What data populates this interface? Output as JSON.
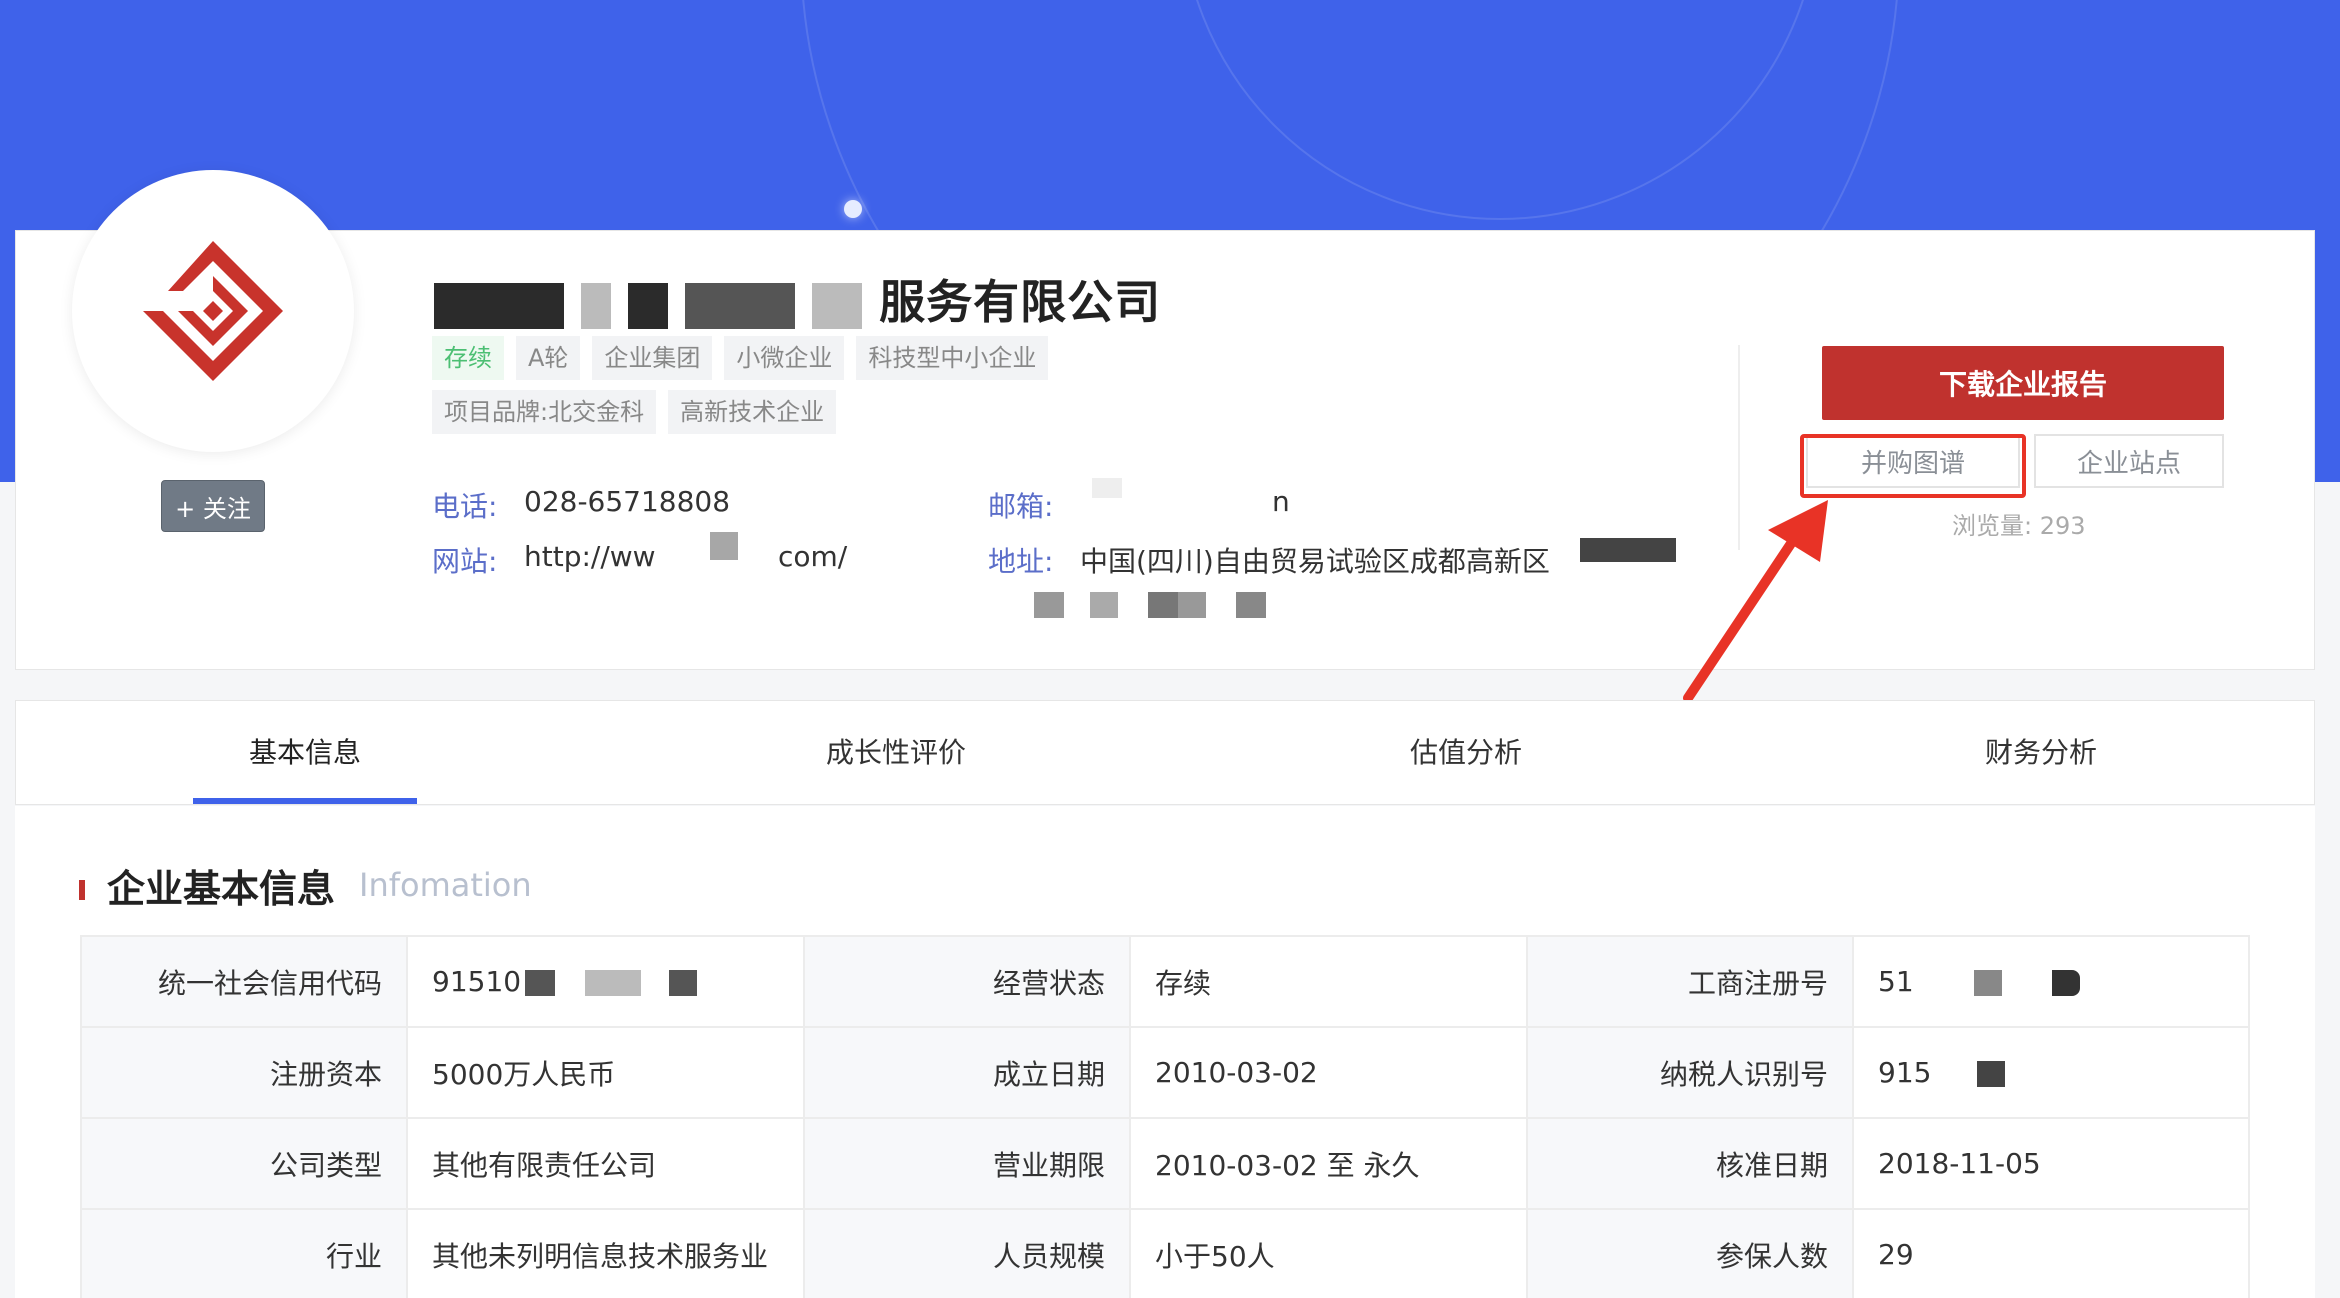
{
  "company": {
    "name_visible": "服务有限公司",
    "tags": [
      {
        "label": "存续",
        "tone": "green"
      },
      {
        "label": "A轮",
        "tone": "gray"
      },
      {
        "label": "企业集团",
        "tone": "gray"
      },
      {
        "label": "小微企业",
        "tone": "gray"
      },
      {
        "label": "科技型中小企业",
        "tone": "gray"
      },
      {
        "label": "项目品牌:北交金科",
        "tone": "gray"
      },
      {
        "label": "高新技术企业",
        "tone": "gray"
      }
    ],
    "follow_label": "+ 关注",
    "phone_label": "电话:",
    "phone_value": "028-65718808",
    "email_label": "邮箱:",
    "email_value_visible": "n",
    "website_label": "网站:",
    "website_prefix": "http://ww",
    "website_suffix": "com/",
    "address_label": "地址:",
    "address_value": "中国(四川)自由贸易试验区成都高新区"
  },
  "actions": {
    "download_label": "下载企业报告",
    "merger_graph_label": "并购图谱",
    "site_label": "企业站点",
    "views_label": "浏览量:",
    "views_value": "293"
  },
  "tabs": [
    {
      "label": "基本信息",
      "active": true
    },
    {
      "label": "成长性评价",
      "active": false
    },
    {
      "label": "估值分析",
      "active": false
    },
    {
      "label": "财务分析",
      "active": false
    }
  ],
  "section": {
    "title": "企业基本信息",
    "subtitle": "Infomation"
  },
  "table": {
    "rows": [
      [
        {
          "k": "统一社会信用代码",
          "v": "91510"
        },
        {
          "k": "经营状态",
          "v": "存续"
        },
        {
          "k": "工商注册号",
          "v": "51"
        }
      ],
      [
        {
          "k": "注册资本",
          "v": "5000万人民币"
        },
        {
          "k": "成立日期",
          "v": "2010-03-02"
        },
        {
          "k": "纳税人识别号",
          "v": "915"
        }
      ],
      [
        {
          "k": "公司类型",
          "v": "其他有限责任公司"
        },
        {
          "k": "营业期限",
          "v": "2010-03-02 至 永久"
        },
        {
          "k": "核准日期",
          "v": "2018-11-05"
        }
      ],
      [
        {
          "k": "行业",
          "v": "其他未列明信息技术服务业"
        },
        {
          "k": "人员规模",
          "v": "小于50人"
        },
        {
          "k": "参保人数",
          "v": "29"
        }
      ]
    ]
  },
  "colors": {
    "hero_blue": "#3f62ea",
    "brand_red": "#c0322e",
    "highlight_red": "#e83326",
    "tag_green": "#4cbf73"
  }
}
